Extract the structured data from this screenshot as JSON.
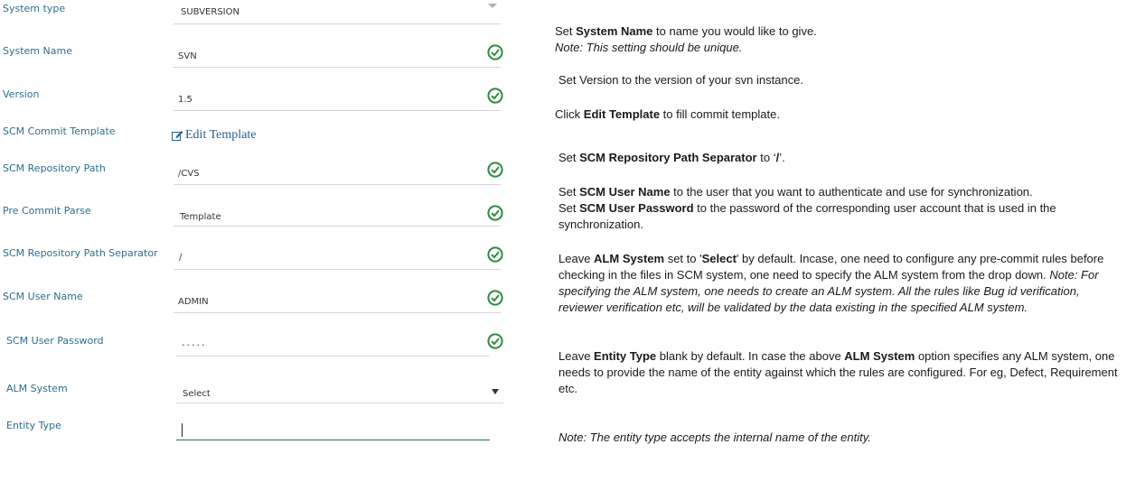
{
  "form": {
    "system_type": {
      "label": "System type",
      "value": "SUBVERSION"
    },
    "system_name": {
      "label": "System Name",
      "value": "SVN"
    },
    "version": {
      "label": "Version",
      "value": "1.5"
    },
    "scm_commit_template": {
      "label": "SCM Commit Template",
      "link": "Edit Template"
    },
    "scm_repository_path": {
      "label": "SCM Repository Path",
      "value": "/CVS"
    },
    "pre_commit_parse": {
      "label": "Pre Commit Parse",
      "value": "Template"
    },
    "scm_repository_path_separator": {
      "label": "SCM Repository Path Separator",
      "value": "/"
    },
    "scm_user_name": {
      "label": "SCM User Name",
      "value": "ADMIN"
    },
    "scm_user_password": {
      "label": "SCM User Password",
      "value": "....."
    },
    "alm_system": {
      "label": "ALM System",
      "value": "Select"
    },
    "entity_type": {
      "label": "Entity Type",
      "value": ""
    }
  },
  "colors": {
    "label": "#2d6e8e",
    "check": "#2e8b3e",
    "focus": "#1f6b6b"
  },
  "icons": {
    "check": "check-circle-icon",
    "edit": "edit-icon",
    "dropdown": "caret-down-icon"
  },
  "help": {
    "p1": {
      "a": "Set ",
      "b": "System Name",
      "c": " to name you would like to give.",
      "note": "Note: This setting should be unique."
    },
    "p2": {
      "a": "Set Version to the version of your svn instance."
    },
    "p3": {
      "a": "Click ",
      "b": "Edit Template",
      "c": " to fill commit template."
    },
    "p4": {
      "a": "Set ",
      "b": "SCM Repository Path Separator",
      "c": " to ‘",
      "d": "/",
      "e": "’."
    },
    "p5": {
      "a": "Set ",
      "b": "SCM User Name",
      "c": " to the user that you want to authenticate and use for synchronization.",
      "d": "Set ",
      "e": "SCM User Password",
      "f": " to the password of the corresponding user account that is used in the synchronization."
    },
    "p6": {
      "a": "Leave ",
      "b": "ALM System",
      "c": " set to '",
      "d": "Select",
      "e": "' by default. Incase, one need to configure any pre-commit rules before checking in the files in SCM system, one need to specify the ALM system from the drop down. ",
      "note": "Note: For specifying the ALM system, one needs to create an ALM system. All the rules like Bug id verification, reviewer verification etc, will be validated by the data existing in the specified ALM system."
    },
    "p7": {
      "a": "Leave ",
      "b": "Entity Type",
      "c": " blank by default. In case the above ",
      "d": "ALM System",
      "e": " option specifies any ALM system, one needs to provide the name of the entity against which the rules are configured. For eg, Defect, Requirement etc."
    },
    "p8": {
      "note": "Note: The entity type accepts the internal name of the entity."
    }
  }
}
